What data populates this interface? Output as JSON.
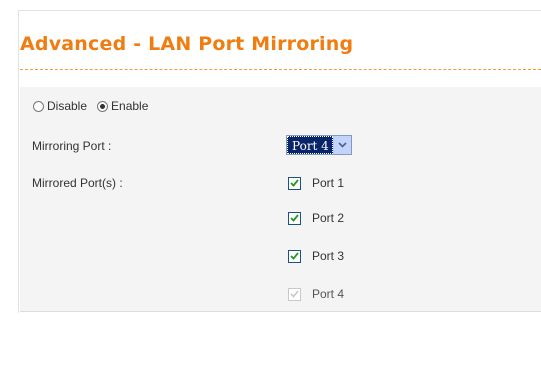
{
  "page": {
    "title": "Advanced - LAN Port Mirroring"
  },
  "mode": {
    "options": [
      {
        "label": "Disable",
        "checked": false
      },
      {
        "label": "Enable",
        "checked": true
      }
    ]
  },
  "mirroring_port": {
    "label": "Mirroring Port :",
    "selected": "Port 4",
    "icon": "chevron-down-icon"
  },
  "mirrored_ports": {
    "label": "Mirrored Port(s) :",
    "items": [
      {
        "label": "Port 1",
        "checked": true,
        "disabled": false
      },
      {
        "label": "Port 2",
        "checked": true,
        "disabled": false
      },
      {
        "label": "Port 3",
        "checked": true,
        "disabled": false
      },
      {
        "label": "Port 4",
        "checked": true,
        "disabled": true
      }
    ]
  },
  "colors": {
    "title": "#f07d12",
    "divider": "#f39c3d",
    "panel_background": "#f4f4f4",
    "checkbox_check": "#1f9b1f",
    "disabled_check": "#c8c8c8"
  }
}
